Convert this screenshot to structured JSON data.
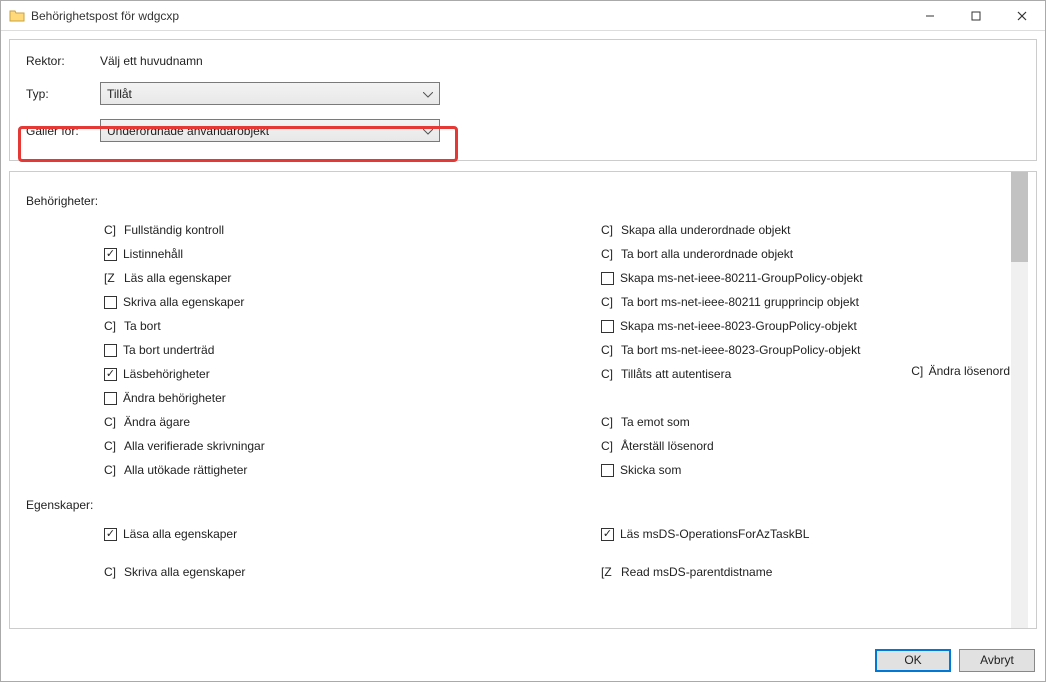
{
  "window": {
    "title": "Behörighetspost för wdgcxp"
  },
  "top": {
    "principal_label": "Rektor:",
    "principal_value": "Välj ett huvudnamn",
    "type_label": "Typ:",
    "type_value": "Tillåt",
    "applies_label": "Gäller för:",
    "applies_value": "Underordnade användarobjekt"
  },
  "sections": {
    "permissions_label": "Behörigheter:",
    "properties_label": "Egenskaper:"
  },
  "permissions_left": [
    {
      "style": "glyph",
      "glyph": "C]",
      "label": "Fullständig kontroll"
    },
    {
      "style": "box",
      "checked": true,
      "label": "Listinnehåll"
    },
    {
      "style": "glyph",
      "glyph": "[Z",
      "label": "Läs alla egenskaper"
    },
    {
      "style": "box",
      "checked": false,
      "label": "Skriva alla egenskaper"
    },
    {
      "style": "glyph",
      "glyph": "C]",
      "label": "Ta bort"
    },
    {
      "style": "box",
      "checked": false,
      "label": "Ta bort underträd"
    },
    {
      "style": "box",
      "checked": true,
      "label": "Läsbehörigheter"
    },
    {
      "style": "box",
      "checked": false,
      "label": "Ändra behörigheter"
    },
    {
      "style": "glyph",
      "glyph": "C]",
      "label": "Ändra ägare"
    },
    {
      "style": "glyph",
      "glyph": "C]",
      "label": "Alla verifierade skrivningar"
    },
    {
      "style": "glyph",
      "glyph": "C]",
      "label": "Alla utökade rättigheter"
    }
  ],
  "permissions_right": [
    {
      "style": "glyph",
      "glyph": "C]",
      "label": "Skapa alla underordnade objekt"
    },
    {
      "style": "glyph",
      "glyph": "C]",
      "label": "Ta bort alla underordnade objekt"
    },
    {
      "style": "box",
      "checked": false,
      "label": "Skapa ms-net-ieee-80211-GroupPolicy-objekt"
    },
    {
      "style": "glyph",
      "glyph": "C]",
      "label": "Ta bort ms-net-ieee-80211 grupprincip objekt"
    },
    {
      "style": "box",
      "checked": false,
      "label": "Skapa ms-net-ieee-8023-GroupPolicy-objekt"
    },
    {
      "style": "glyph",
      "glyph": "C]",
      "label": "Ta bort ms-net-ieee-8023-GroupPolicy-objekt"
    },
    {
      "style": "glyph",
      "glyph": "C]",
      "label": "Tillåts att autentisera"
    },
    {
      "style": "none",
      "label": ""
    },
    {
      "style": "glyph",
      "glyph": "C]",
      "label": "Ta emot som"
    },
    {
      "style": "glyph",
      "glyph": "C]",
      "label": "Återställ lösenord"
    },
    {
      "style": "box",
      "checked": false,
      "label": "Skicka som"
    }
  ],
  "overflow_item": {
    "glyph": "C]",
    "label": "Ändra lösenord"
  },
  "properties_left": [
    {
      "style": "box",
      "checked": true,
      "label": "Läsa alla egenskaper"
    },
    {
      "style": "spacer"
    },
    {
      "style": "glyph",
      "glyph": "C]",
      "label": "Skriva alla egenskaper"
    }
  ],
  "properties_right": [
    {
      "style": "box",
      "checked": true,
      "label": "Läs msDS-OperationsForAzTaskBL"
    },
    {
      "style": "spacer"
    },
    {
      "style": "glyph",
      "glyph": "[Z",
      "label": "Read msDS-parentdistname"
    }
  ],
  "footer": {
    "ok": "OK",
    "cancel": "Avbryt"
  }
}
